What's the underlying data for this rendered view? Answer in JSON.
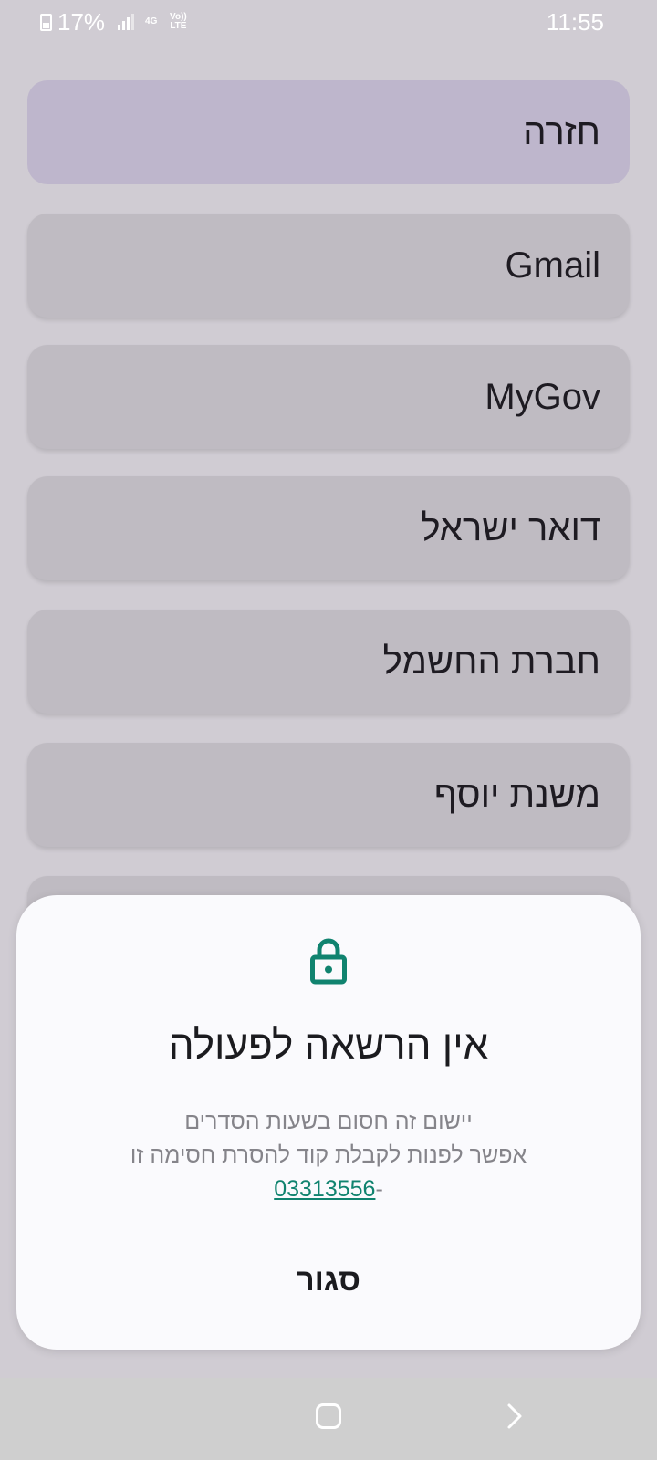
{
  "status_bar": {
    "battery_percent": "17%",
    "network_type": "4G",
    "volte_label": "Vo)) LTE",
    "time": "11:55"
  },
  "menu": {
    "items": [
      {
        "label": "חזרה"
      },
      {
        "label": "Gmail"
      },
      {
        "label": "MyGov"
      },
      {
        "label": "דואר ישראל"
      },
      {
        "label": "חברת החשמל"
      },
      {
        "label": "משנת יוסף"
      }
    ]
  },
  "dialog": {
    "icon": "lock-icon",
    "title": "אין הרשאה לפעולה",
    "line1": "יישום זה חסום בשעות הסדרים",
    "line2": "אפשר לפנות לקבלת קוד להסרת חסימה זו",
    "phone_prefix": "-",
    "phone": "03313556",
    "close_label": "סגור"
  },
  "colors": {
    "accent": "#10836f",
    "menu_item": "#bfbbc2",
    "back_item": "#beb6cc",
    "sheet": "#fafafd"
  }
}
